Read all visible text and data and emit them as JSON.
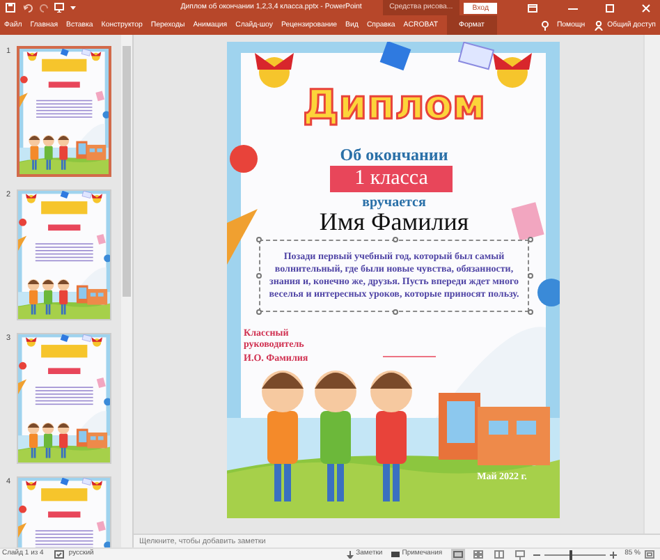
{
  "window": {
    "title": "Диплом об окончании 1,2,3,4 класса.pptx  -  PowerPoint",
    "context_group": "Средства рисова...",
    "sign_in": "Вход"
  },
  "ribbon_tabs": [
    {
      "label": "Файл",
      "kind": "file",
      "selected": false
    },
    {
      "label": "Главная",
      "kind": "plain",
      "selected": false
    },
    {
      "label": "Вставка",
      "kind": "plain",
      "selected": false
    },
    {
      "label": "Конструктор",
      "kind": "plain",
      "selected": false
    },
    {
      "label": "Переходы",
      "kind": "plain",
      "selected": false
    },
    {
      "label": "Анимация",
      "kind": "plain",
      "selected": false
    },
    {
      "label": "Слайд-шоу",
      "kind": "plain",
      "selected": false
    },
    {
      "label": "Рецензирование",
      "kind": "plain",
      "selected": false
    },
    {
      "label": "Вид",
      "kind": "plain",
      "selected": false
    },
    {
      "label": "Справка",
      "kind": "plain",
      "selected": false
    },
    {
      "label": "ACROBAT",
      "kind": "plain",
      "selected": false
    },
    {
      "label": "Формат",
      "kind": "context",
      "selected": false
    }
  ],
  "help": "Помощн",
  "share": "Общий доступ",
  "slides_pane": [
    {
      "number": "1",
      "selected": true
    },
    {
      "number": "2",
      "selected": false
    },
    {
      "number": "3",
      "selected": false
    },
    {
      "number": "4",
      "selected": false
    }
  ],
  "slide": {
    "title": "Диплом",
    "line_1": "Об окончании",
    "ribbon": "1 класса",
    "line_2": "вручается",
    "name": "Имя Фамилия",
    "wish": "Позади первый учебный год, который был самый волнительный, где были новые чувства, обязанности, знания и, конечно же, друзья. Пусть впереди ждет много веселья и интересных уроков, которые приносят пользу.",
    "teacher_label": "Классный руководитель",
    "teacher_name": "И.О. Фамилия",
    "date": "Май 2022 г."
  },
  "notes_placeholder": "Щелкните, чтобы добавить заметки",
  "status_bar": {
    "slide_info": "Слайд 1 из 4",
    "language": "русский",
    "notes": "Заметки",
    "comments": "Примечания",
    "zoom_slider": {
      "level": 0.45
    },
    "zoom": "85 %"
  }
}
